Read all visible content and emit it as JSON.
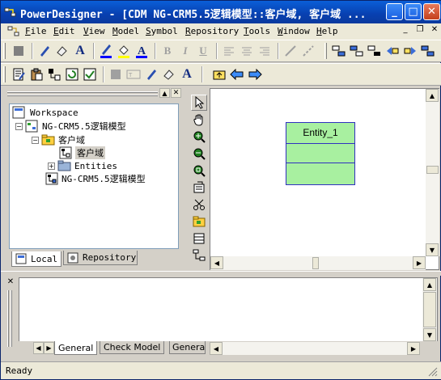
{
  "window": {
    "title": "PowerDesigner - [CDM NG-CRM5.5逻辑模型::客户域, 客户域 ...",
    "minimize_label": "_",
    "maximize_label": "□",
    "close_label": "✕"
  },
  "menu": {
    "items": [
      "File",
      "Edit",
      "View",
      "Model",
      "Symbol",
      "Repository",
      "Tools",
      "Window",
      "Help"
    ]
  },
  "mdi_controls": {
    "minimize": "_",
    "restore": "❐",
    "close": "✕"
  },
  "browser": {
    "root": "Workspace",
    "model": "NG-CRM5.5逻辑模型",
    "package": "客户域",
    "diagram": "客户域",
    "entities": "Entities",
    "model2": "NG-CRM5.5逻辑模型",
    "tab_local": "Local",
    "tab_repository": "Repository"
  },
  "diagram": {
    "entity_name": "Entity_1"
  },
  "output": {
    "tabs": [
      "General",
      "Check Model",
      "Genera"
    ]
  },
  "status": {
    "text": "Ready"
  },
  "colors": {
    "entity_fill": "#a8f0a0",
    "entity_border": "#3030c0",
    "title_bar": "#0a5fd8"
  },
  "icons": {
    "toolbar1": [
      "open-icon",
      "pen-icon",
      "eraser-icon",
      "font-icon",
      "pen-blue-icon",
      "fill-icon",
      "font-color-icon",
      "bold-icon",
      "italic-icon",
      "underline-icon",
      "align-left-icon",
      "align-center-icon",
      "align-right-icon",
      "link-icon",
      "unlink-icon",
      "move-left-icon",
      "move-right-icon",
      "tree-icon",
      "tree2-icon",
      "tree3-icon",
      "tree4-icon",
      "tree5-icon",
      "tree6-icon"
    ],
    "toolbar2": [
      "properties-icon",
      "paste-icon",
      "grid-icon",
      "refresh-icon",
      "check-icon",
      "stop-icon",
      "text-icon",
      "pen-icon",
      "eraser-icon",
      "font-icon",
      "up-folder-icon",
      "back-icon",
      "forward-icon"
    ],
    "palette": [
      "pointer-icon",
      "hand-icon",
      "zoom-in-icon",
      "zoom-out-icon",
      "zoom-fit-icon",
      "open-diagram-icon",
      "cut-icon",
      "package-icon",
      "entity-icon",
      "inheritance-icon"
    ]
  }
}
